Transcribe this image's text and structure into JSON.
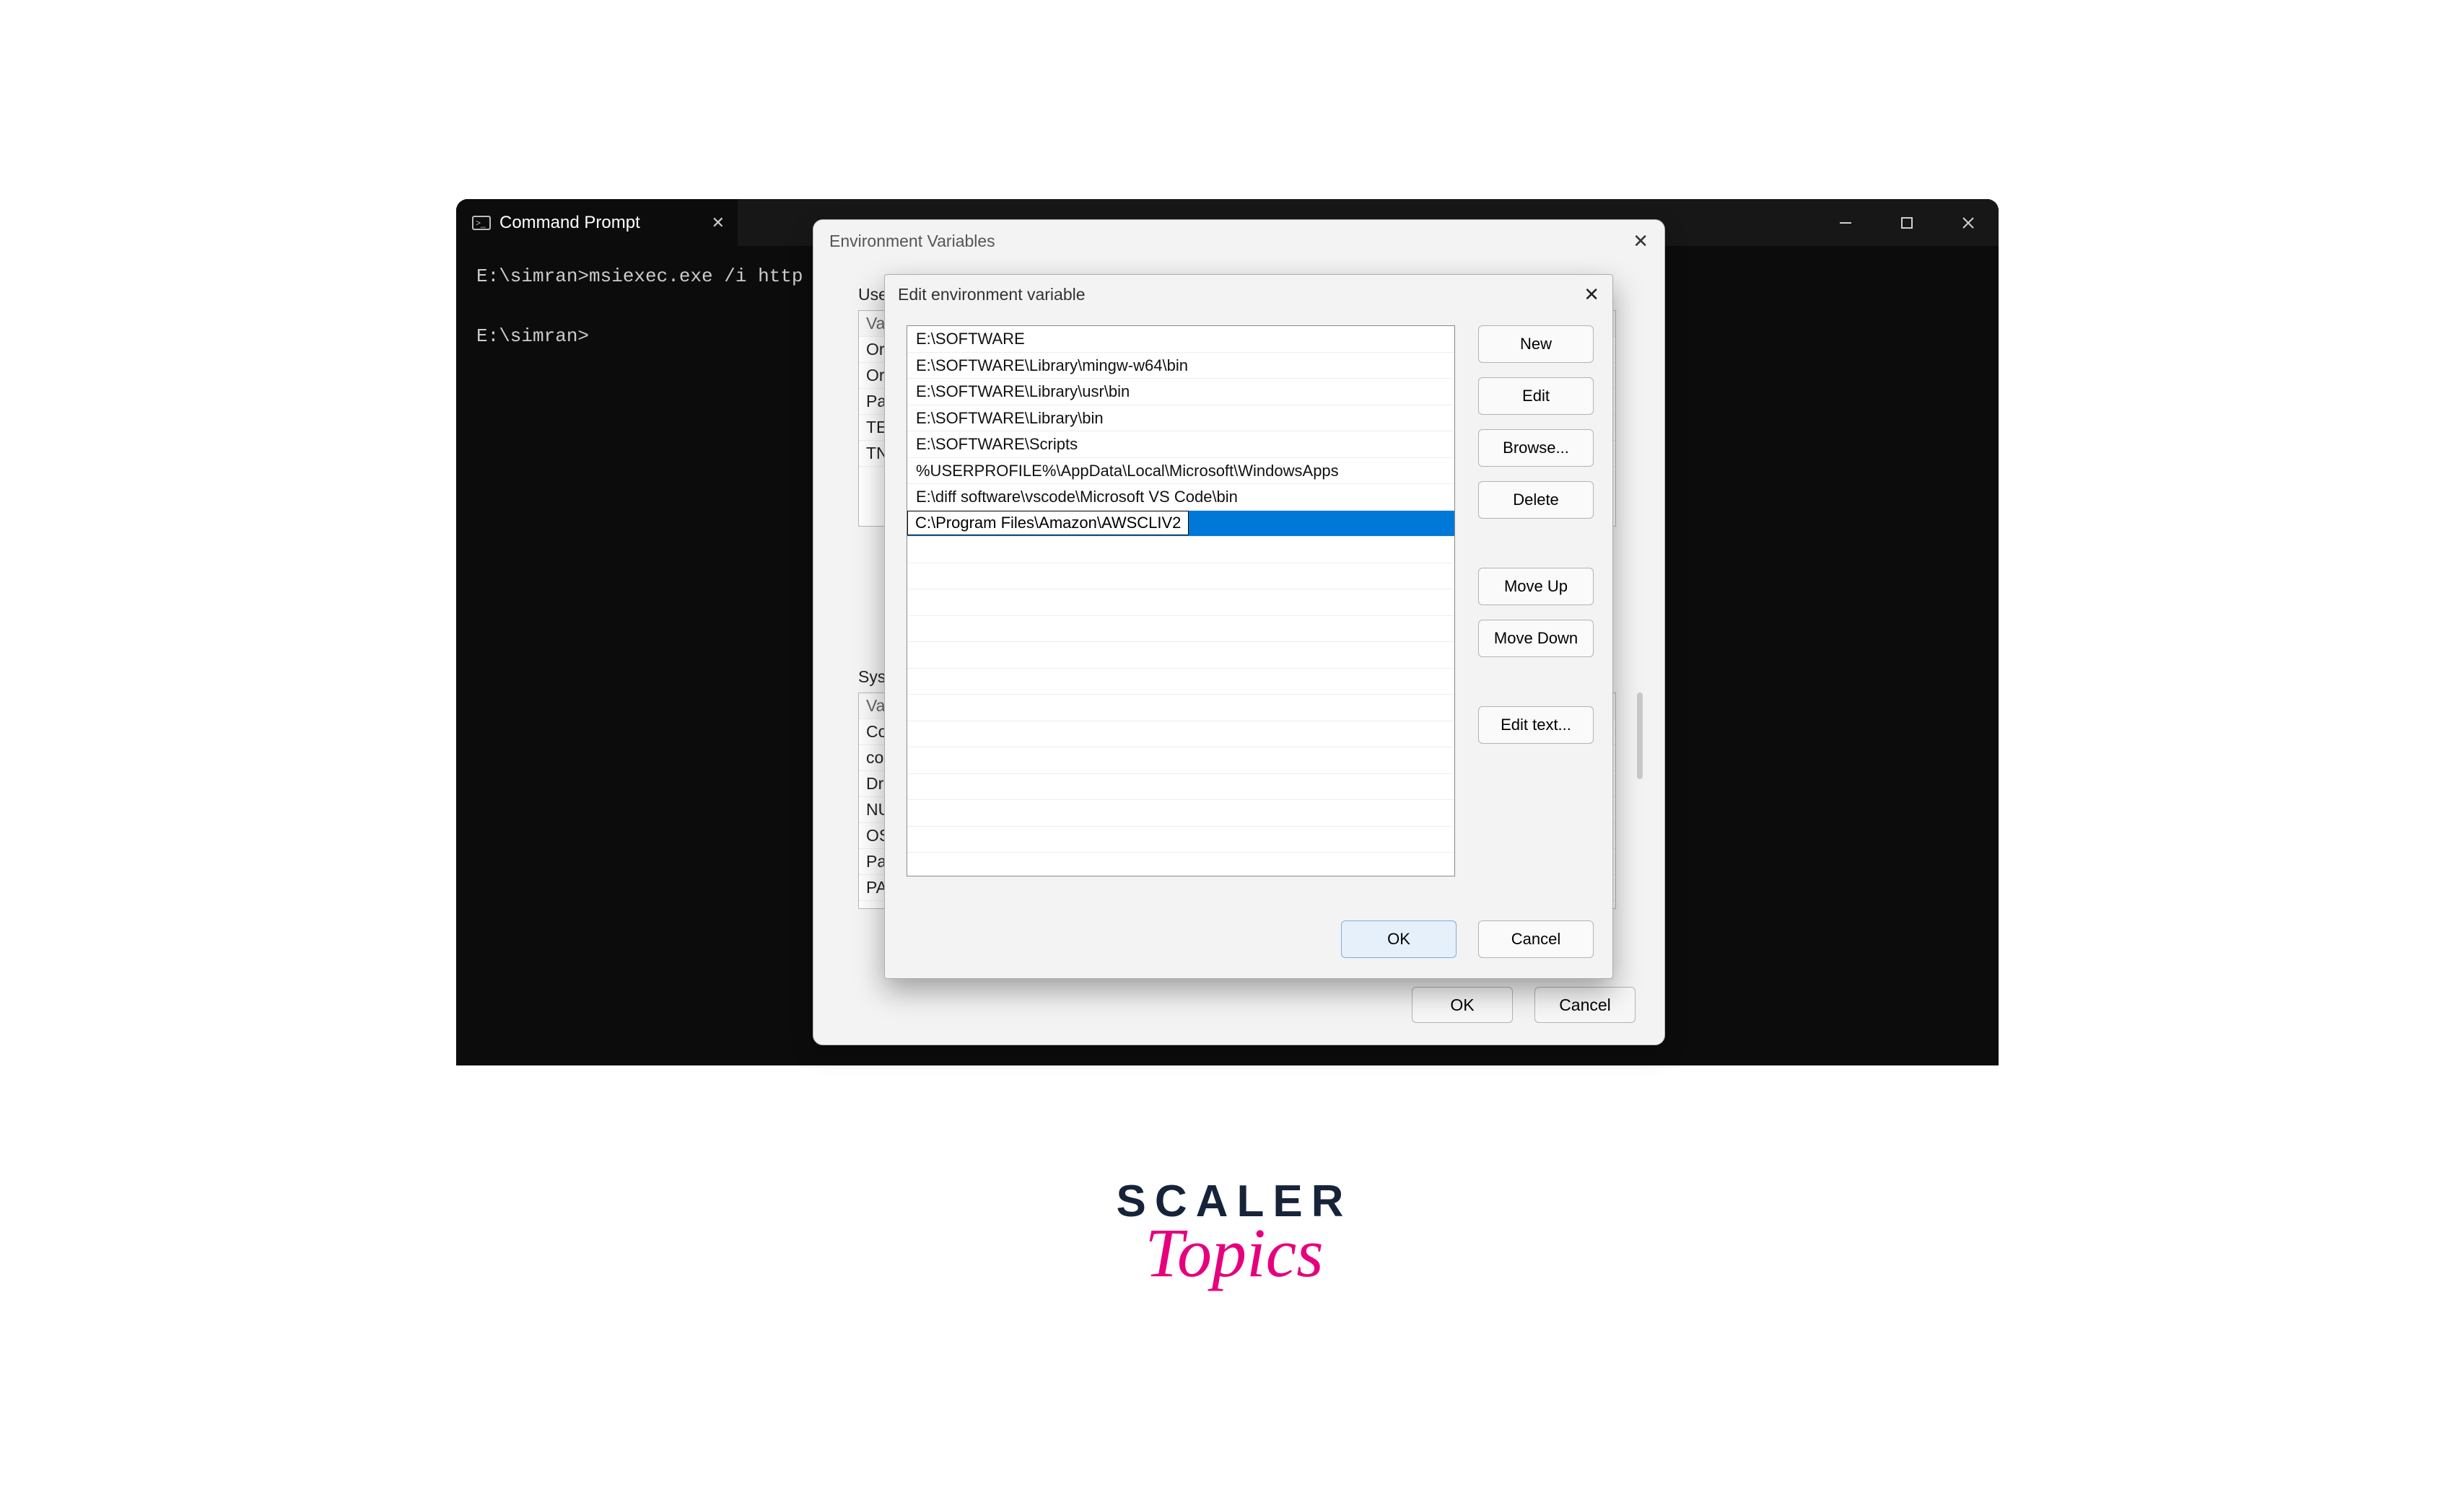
{
  "terminal": {
    "tab_title": "Command Prompt",
    "lines": [
      "E:\\simran>msiexec.exe /i http",
      "",
      "E:\\simran>"
    ]
  },
  "env_dialog": {
    "title": "Environment Variables",
    "user_label": "User",
    "sys_label": "Syst",
    "user_rows": [
      "Va",
      "Or",
      "Or",
      "Pa",
      "TE",
      "TN"
    ],
    "sys_rows": [
      "Va",
      "Co",
      "co",
      "Dr",
      "NU",
      "OS",
      "Pa",
      "PA"
    ],
    "ok": "OK",
    "cancel": "Cancel"
  },
  "edit_dialog": {
    "title": "Edit environment variable",
    "paths": [
      "E:\\SOFTWARE",
      "E:\\SOFTWARE\\Library\\mingw-w64\\bin",
      "E:\\SOFTWARE\\Library\\usr\\bin",
      "E:\\SOFTWARE\\Library\\bin",
      "E:\\SOFTWARE\\Scripts",
      "%USERPROFILE%\\AppData\\Local\\Microsoft\\WindowsApps",
      "E:\\diff software\\vscode\\Microsoft VS Code\\bin"
    ],
    "editing_value": "C:\\Program Files\\Amazon\\AWSCLIV2",
    "buttons": {
      "new": "New",
      "edit": "Edit",
      "browse": "Browse...",
      "delete": "Delete",
      "moveup": "Move Up",
      "movedown": "Move Down",
      "edittext": "Edit text...",
      "ok": "OK",
      "cancel": "Cancel"
    }
  },
  "logo": {
    "line1": "SCALER",
    "line2": "Topics"
  }
}
